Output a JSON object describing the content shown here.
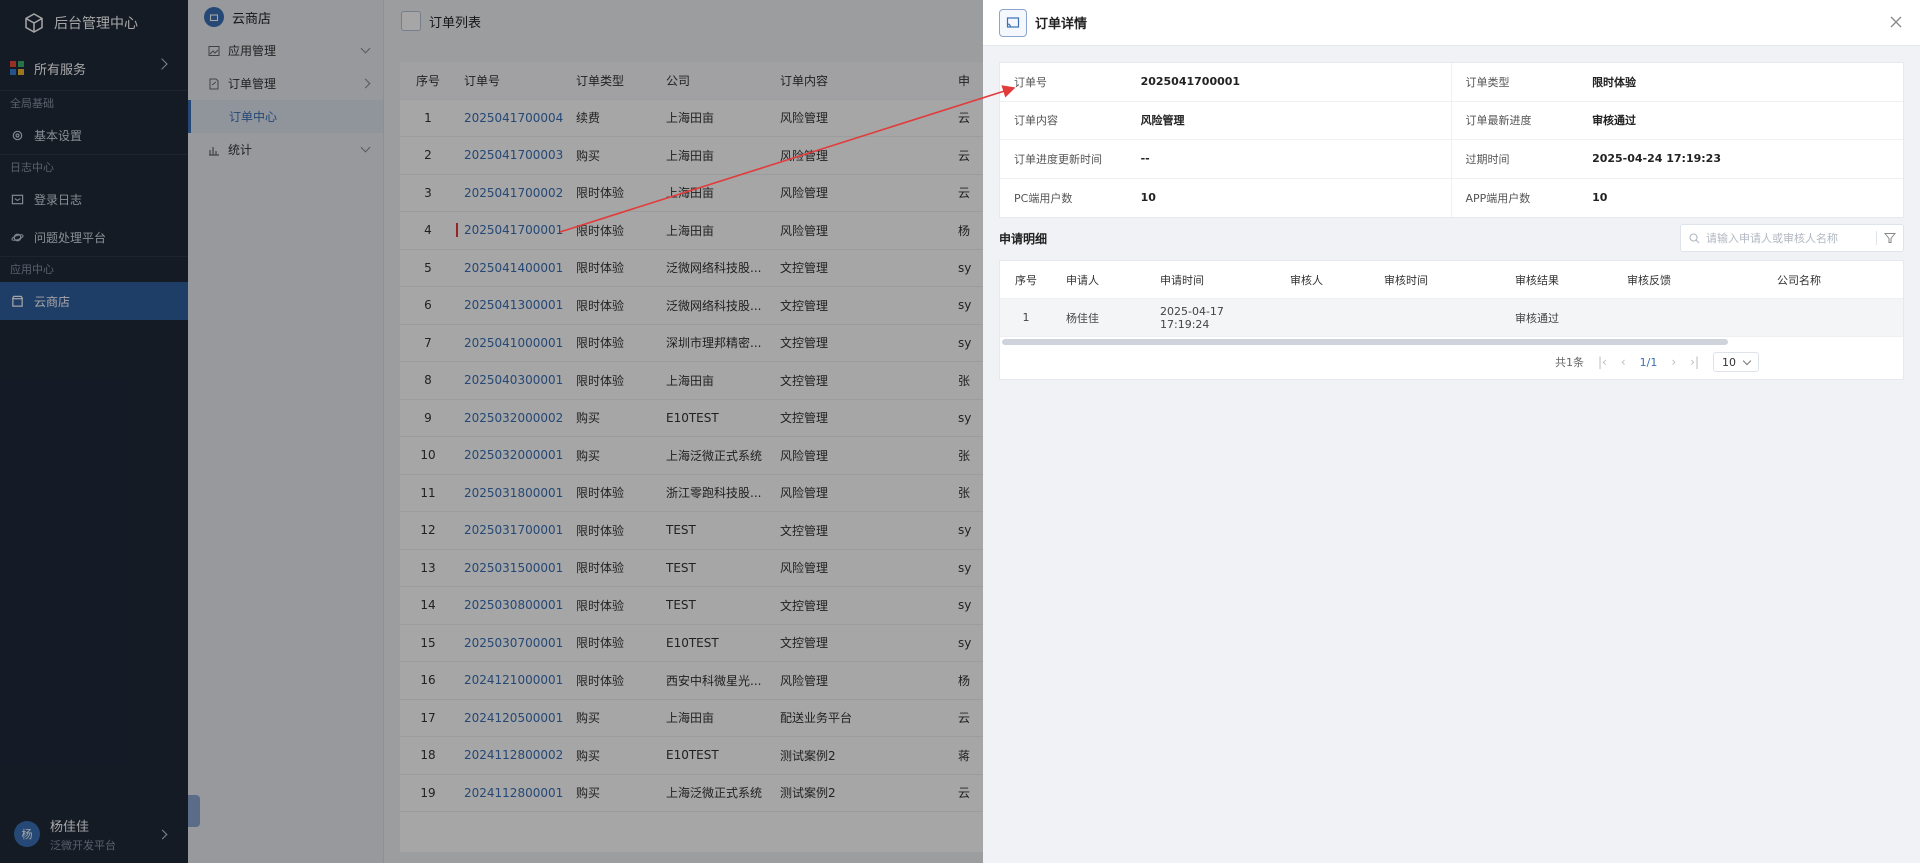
{
  "nav": {
    "brand": "后台管理中心",
    "all_services": "所有服务",
    "sections": [
      {
        "title": "全局基础",
        "items": [
          {
            "label": "基本设置",
            "icon": "gear-icon"
          }
        ]
      },
      {
        "title": "日志中心",
        "items": [
          {
            "label": "登录日志",
            "icon": "log-icon"
          },
          {
            "label": "问题处理平台",
            "icon": "planet-icon"
          }
        ]
      },
      {
        "title": "应用中心",
        "items": [
          {
            "label": "云商店",
            "icon": "store-icon",
            "active": true
          }
        ]
      }
    ],
    "user": {
      "avatar": "杨",
      "name": "杨佳佳",
      "org": "泛微开发平台"
    }
  },
  "submenu": {
    "title": "云商店",
    "items": [
      {
        "label": "应用管理"
      },
      {
        "label": "订单管理"
      },
      {
        "label": "订单中心",
        "child": true
      },
      {
        "label": "统计"
      }
    ]
  },
  "list": {
    "title": "订单列表",
    "columns": [
      "序号",
      "订单号",
      "订单类型",
      "公司",
      "订单内容",
      "申"
    ],
    "rows": [
      {
        "no": "1",
        "id": "2025041700004",
        "type": "续费",
        "company": "上海田亩",
        "content": "风险管理",
        "extra": "云"
      },
      {
        "no": "2",
        "id": "2025041700003",
        "type": "购买",
        "company": "上海田亩",
        "content": "风险管理",
        "extra": "云"
      },
      {
        "no": "3",
        "id": "2025041700002",
        "type": "限时体验",
        "company": "上海田亩",
        "content": "风险管理",
        "extra": "云"
      },
      {
        "no": "4",
        "id": "2025041700001",
        "type": "限时体验",
        "company": "上海田亩",
        "content": "风险管理",
        "extra": "杨"
      },
      {
        "no": "5",
        "id": "2025041400001",
        "type": "限时体验",
        "company": "泛微网络科技股...",
        "content": "文控管理",
        "extra": "sy"
      },
      {
        "no": "6",
        "id": "2025041300001",
        "type": "限时体验",
        "company": "泛微网络科技股...",
        "content": "文控管理",
        "extra": "sy"
      },
      {
        "no": "7",
        "id": "2025041000001",
        "type": "限时体验",
        "company": "深圳市理邦精密...",
        "content": "文控管理",
        "extra": "sy"
      },
      {
        "no": "8",
        "id": "2025040300001",
        "type": "限时体验",
        "company": "上海田亩",
        "content": "文控管理",
        "extra": "张"
      },
      {
        "no": "9",
        "id": "2025032000002",
        "type": "购买",
        "company": "E10TEST",
        "content": "文控管理",
        "extra": "sy"
      },
      {
        "no": "10",
        "id": "2025032000001",
        "type": "购买",
        "company": "上海泛微正式系统",
        "content": "风险管理",
        "extra": "张"
      },
      {
        "no": "11",
        "id": "2025031800001",
        "type": "限时体验",
        "company": "浙江零跑科技股...",
        "content": "风险管理",
        "extra": "张"
      },
      {
        "no": "12",
        "id": "2025031700001",
        "type": "限时体验",
        "company": "TEST",
        "content": "文控管理",
        "extra": "sy"
      },
      {
        "no": "13",
        "id": "2025031500001",
        "type": "限时体验",
        "company": "TEST",
        "content": "风险管理",
        "extra": "sy"
      },
      {
        "no": "14",
        "id": "2025030800001",
        "type": "限时体验",
        "company": "TEST",
        "content": "文控管理",
        "extra": "sy"
      },
      {
        "no": "15",
        "id": "2025030700001",
        "type": "限时体验",
        "company": "E10TEST",
        "content": "文控管理",
        "extra": "sy"
      },
      {
        "no": "16",
        "id": "2024121000001",
        "type": "限时体验",
        "company": "西安中科微星光...",
        "content": "风险管理",
        "extra": "杨"
      },
      {
        "no": "17",
        "id": "2024120500001",
        "type": "购买",
        "company": "上海田亩",
        "content": "配送业务平台",
        "extra": "云"
      },
      {
        "no": "18",
        "id": "2024112800002",
        "type": "购买",
        "company": "E10TEST",
        "content": "测试案例2",
        "extra": "蒋"
      },
      {
        "no": "19",
        "id": "2024112800001",
        "type": "购买",
        "company": "上海泛微正式系统",
        "content": "测试案例2",
        "extra": "云"
      }
    ]
  },
  "drawer": {
    "title": "订单详情",
    "info": [
      {
        "k1": "订单号",
        "v1": "2025041700001",
        "k2": "订单类型",
        "v2": "限时体验"
      },
      {
        "k1": "订单内容",
        "v1": "风险管理",
        "k2": "订单最新进度",
        "v2": "审核通过"
      },
      {
        "k1": "订单进度更新时间",
        "v1": "--",
        "k2": "过期时间",
        "v2": "2025-04-24 17:19:23"
      },
      {
        "k1": "PC端用户数",
        "v1": "10",
        "k2": "APP端用户数",
        "v2": "10"
      }
    ],
    "apply_title": "申请明细",
    "search_placeholder": "请输入申请人或审核人名称",
    "apply_columns": [
      "序号",
      "申请人",
      "申请时间",
      "审核人",
      "审核时间",
      "审核结果",
      "审核反馈",
      "公司名称"
    ],
    "apply_rows": [
      [
        "1",
        "杨佳佳",
        "2025-04-17 17:19:24",
        "",
        "",
        "审核通过",
        "",
        ""
      ]
    ],
    "pager": {
      "total": "共1条",
      "page": "1/1",
      "size": "10"
    }
  },
  "colors": {
    "nav_bg": "#1f2a3a",
    "active": "#2f5e9e",
    "link": "#3a6fb5",
    "highlight": "#e23b3b"
  }
}
